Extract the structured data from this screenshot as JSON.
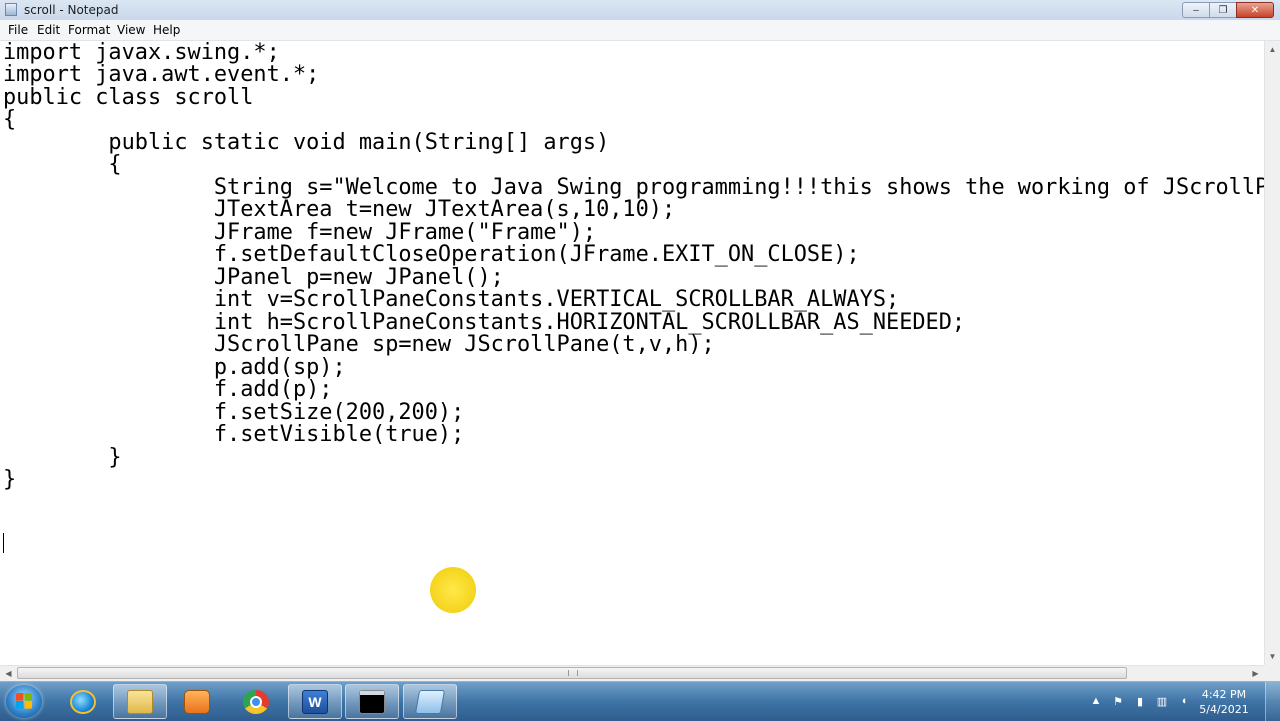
{
  "window": {
    "title": "scroll - Notepad",
    "controls": {
      "minimize": "–",
      "maximize": "❐",
      "close": "✕"
    }
  },
  "menu": [
    "File",
    "Edit",
    "Format",
    "View",
    "Help"
  ],
  "code_lines": [
    "import javax.swing.*;",
    "import java.awt.event.*;",
    "public class scroll",
    "{",
    "        public static void main(String[] args)",
    "        {",
    "                String s=\"Welcome to Java Swing programming!!!this shows the working of JScrollP",
    "                JTextArea t=new JTextArea(s,10,10);",
    "                JFrame f=new JFrame(\"Frame\");",
    "                f.setDefaultCloseOperation(JFrame.EXIT_ON_CLOSE);",
    "                JPanel p=new JPanel();",
    "                int v=ScrollPaneConstants.VERTICAL_SCROLLBAR_ALWAYS;",
    "                int h=ScrollPaneConstants.HORIZONTAL_SCROLLBAR_AS_NEEDED;",
    "                JScrollPane sp=new JScrollPane(t,v,h);",
    "                p.add(sp);",
    "                f.add(p);",
    "                f.setSize(200,200);",
    "                f.setVisible(true);",
    "        }",
    "}"
  ],
  "taskbar": {
    "apps": [
      {
        "name": "internet-explorer-icon"
      },
      {
        "name": "windows-explorer-icon"
      },
      {
        "name": "media-player-icon"
      },
      {
        "name": "chrome-icon"
      },
      {
        "name": "word-icon",
        "glyph": "W"
      },
      {
        "name": "command-prompt-icon"
      },
      {
        "name": "notepad-icon"
      }
    ],
    "clock": {
      "time": "4:42 PM",
      "date": "5/4/2021"
    }
  }
}
